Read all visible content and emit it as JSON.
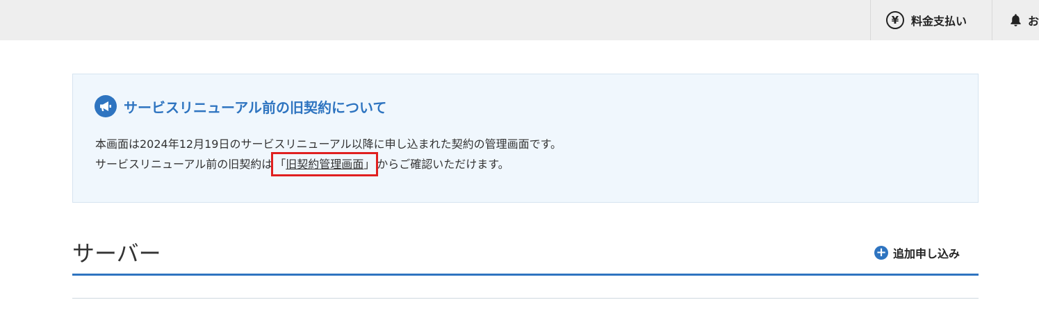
{
  "topbar": {
    "payment_label": "料金支払い",
    "notifications_label": "お"
  },
  "notice": {
    "title": "サービスリニューアル前の旧契約について",
    "line1": "本画面は2024年12月19日のサービスリニューアル以降に申し込まれた契約の管理画面です。",
    "line2_before": "サービスリニューアル前の旧契約は",
    "bracket_open": "「",
    "link_label": "旧契約管理画面",
    "bracket_close": "」",
    "line2_after": "からご確認いただけます。"
  },
  "section": {
    "title": "サーバー",
    "add_label": "追加申し込み"
  },
  "colors": {
    "accent": "#2e74c0",
    "highlight": "#e02020",
    "notice_bg": "#f0f7fd"
  }
}
